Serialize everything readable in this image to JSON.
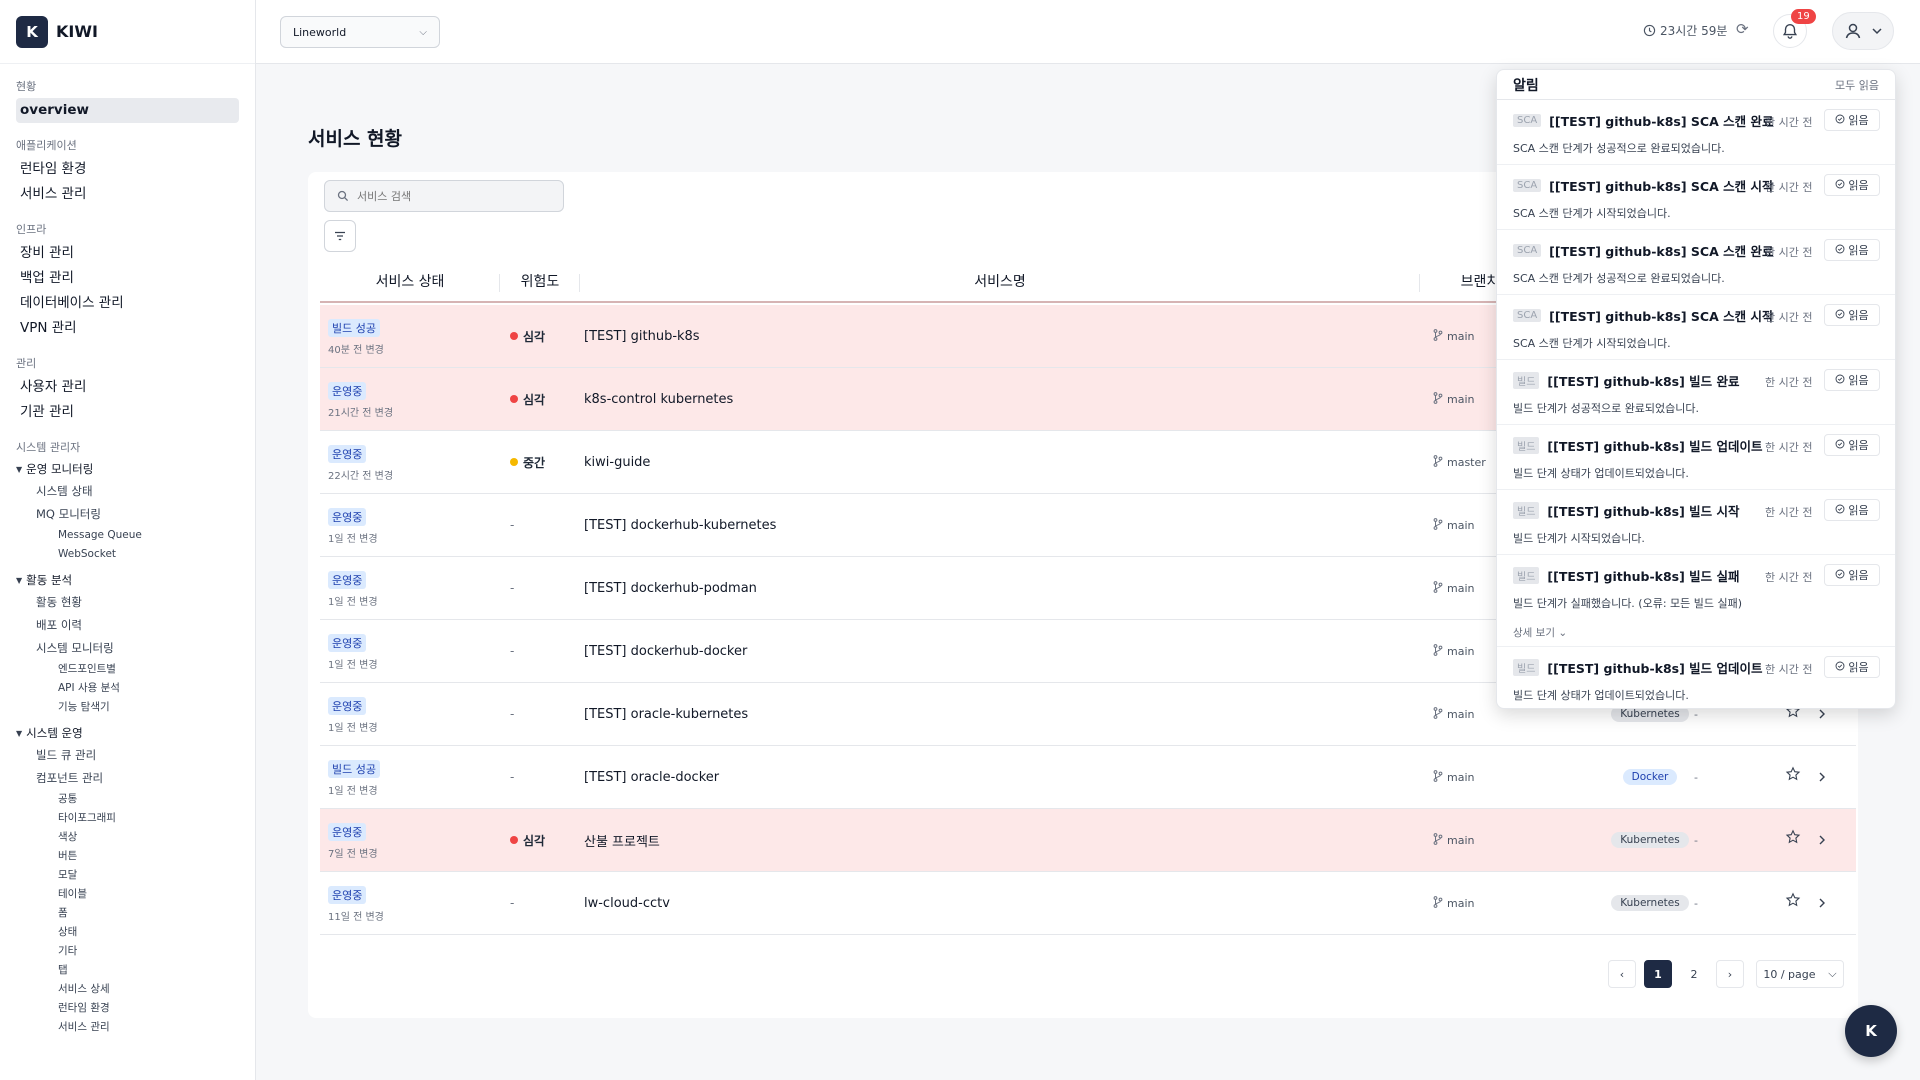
{
  "brand": {
    "logo": "K",
    "name": "KIWI"
  },
  "topbar": {
    "org": "Lineworld",
    "timer": "23시간 59분",
    "notif_count": "19"
  },
  "sidebar": {
    "groups": [
      {
        "title": "현황",
        "items": [
          "overview"
        ]
      },
      {
        "title": "애플리케이션",
        "items": [
          "런타임 환경",
          "서비스 관리"
        ]
      },
      {
        "title": "인프라",
        "items": [
          "장비 관리",
          "백업 관리",
          "데이터베이스 관리",
          "VPN 관리"
        ]
      },
      {
        "title": "관리",
        "items": [
          "사용자 관리",
          "기관 관리"
        ]
      }
    ],
    "admin_title": "시스템 관리자",
    "tree": {
      "monitoring": {
        "label": "운영 모니터링",
        "items": [
          "시스템 상태",
          "MQ 모니터링"
        ],
        "mq_sub": [
          "Message Queue",
          "WebSocket"
        ]
      },
      "activity": {
        "label": "활동 분석",
        "items": [
          "활동 현황",
          "배포 이력",
          "시스템 모니터링"
        ],
        "sys_sub": [
          "엔드포인트별",
          "API 사용 분석",
          "기능 탐색기"
        ]
      },
      "ops": {
        "label": "시스템 운영",
        "items": [
          "빌드 큐 관리",
          "컴포넌트 관리"
        ],
        "comp_sub": [
          "공통",
          "타이포그래피",
          "색상",
          "버튼",
          "모달",
          "테이블",
          "폼",
          "상태",
          "기타",
          "탭",
          "서비스 상세",
          "런타임 환경",
          "서비스 관리"
        ]
      }
    }
  },
  "main": {
    "title": "서비스 현황",
    "search_placeholder": "서비스 검색",
    "headers": {
      "status": "서비스 상태",
      "risk": "위험도",
      "name": "서비스명",
      "branch": "브랜치"
    },
    "rows": [
      {
        "status": "빌드 성공",
        "time": "40분 전 변경",
        "risk": "심각",
        "name": "[TEST] github-k8s",
        "branch": "main",
        "type": "",
        "extra": ""
      },
      {
        "status": "운영중",
        "time": "21시간 전 변경",
        "risk": "심각",
        "name": "k8s-control kubernetes",
        "branch": "main",
        "type": "",
        "extra": ""
      },
      {
        "status": "운영중",
        "time": "22시간 전 변경",
        "risk": "중간",
        "name": "kiwi-guide",
        "branch": "master",
        "type": "",
        "extra": ""
      },
      {
        "status": "운영중",
        "time": "1일 전 변경",
        "risk": "-",
        "name": "[TEST] dockerhub-kubernetes",
        "branch": "main",
        "type": "",
        "extra": ""
      },
      {
        "status": "운영중",
        "time": "1일 전 변경",
        "risk": "-",
        "name": "[TEST] dockerhub-podman",
        "branch": "main",
        "type": "",
        "extra": ""
      },
      {
        "status": "운영중",
        "time": "1일 전 변경",
        "risk": "-",
        "name": "[TEST] dockerhub-docker",
        "branch": "main",
        "type": "",
        "extra": ""
      },
      {
        "status": "운영중",
        "time": "1일 전 변경",
        "risk": "-",
        "name": "[TEST] oracle-kubernetes",
        "branch": "main",
        "type": "Kubernetes",
        "extra": "-"
      },
      {
        "status": "빌드 성공",
        "time": "1일 전 변경",
        "risk": "-",
        "name": "[TEST] oracle-docker",
        "branch": "main",
        "type": "Docker",
        "extra": "-"
      },
      {
        "status": "운영중",
        "time": "7일 전 변경",
        "risk": "심각",
        "name": "산불 프로젝트",
        "branch": "main",
        "type": "Kubernetes",
        "extra": "-"
      },
      {
        "status": "운영중",
        "time": "11일 전 변경",
        "risk": "-",
        "name": "lw-cloud-cctv",
        "branch": "main",
        "type": "Kubernetes",
        "extra": "-"
      }
    ],
    "pagination": {
      "pages": [
        "1",
        "2"
      ],
      "per_page": "10 / page"
    }
  },
  "notifications": {
    "title": "알림",
    "read_all": "모두 읽음",
    "read_label": "읽음",
    "more_label": "상세 보기",
    "items": [
      {
        "tag": "SCA",
        "title": "[[TEST] github-k8s] SCA 스캔 완료",
        "ago": "한 시간 전",
        "body": "SCA 스캔 단계가 성공적으로 완료되었습니다."
      },
      {
        "tag": "SCA",
        "title": "[[TEST] github-k8s] SCA 스캔 시작",
        "ago": "한 시간 전",
        "body": "SCA 스캔 단계가 시작되었습니다."
      },
      {
        "tag": "SCA",
        "title": "[[TEST] github-k8s] SCA 스캔 완료",
        "ago": "한 시간 전",
        "body": "SCA 스캔 단계가 성공적으로 완료되었습니다."
      },
      {
        "tag": "SCA",
        "title": "[[TEST] github-k8s] SCA 스캔 시작",
        "ago": "한 시간 전",
        "body": "SCA 스캔 단계가 시작되었습니다."
      },
      {
        "tag": "빌드",
        "title": "[[TEST] github-k8s] 빌드 완료",
        "ago": "한 시간 전",
        "body": "빌드 단계가 성공적으로 완료되었습니다."
      },
      {
        "tag": "빌드",
        "title": "[[TEST] github-k8s] 빌드 업데이트",
        "ago": "한 시간 전",
        "body": "빌드 단계 상태가 업데이트되었습니다."
      },
      {
        "tag": "빌드",
        "title": "[[TEST] github-k8s] 빌드 시작",
        "ago": "한 시간 전",
        "body": "빌드 단계가 시작되었습니다."
      },
      {
        "tag": "빌드",
        "title": "[[TEST] github-k8s] 빌드 실패",
        "ago": "한 시간 전",
        "body": "빌드 단계가 실패했습니다. (오류: 모든 빌드 실패)"
      },
      {
        "tag": "빌드",
        "title": "[[TEST] github-k8s] 빌드 업데이트",
        "ago": "한 시간 전",
        "body": "빌드 단계 상태가 업데이트되었습니다."
      }
    ]
  },
  "fab": {
    "label": "K"
  },
  "colors": {
    "accent": "#1e2a44",
    "danger_row": "#fde8e8",
    "risk_critical": "#ef4444",
    "risk_medium": "#f5b800",
    "badge": "#ef4444"
  }
}
